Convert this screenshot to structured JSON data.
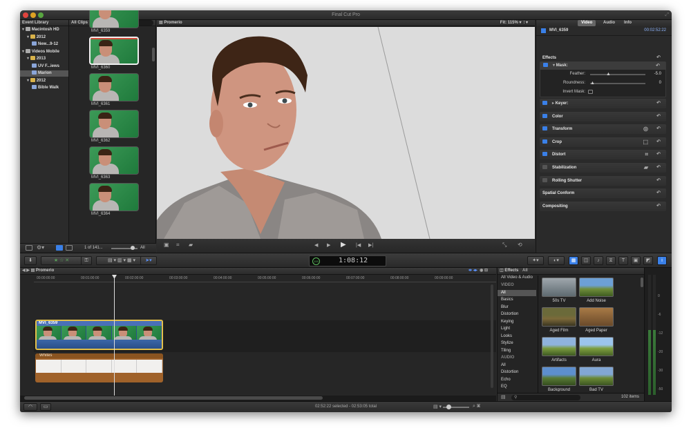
{
  "app": {
    "title": "Final Cut Pro"
  },
  "event_library": {
    "header": "Event Library",
    "items": [
      {
        "label": "Macintosh HD",
        "indent": 0,
        "sel": false
      },
      {
        "label": "2012",
        "indent": 1,
        "sel": false
      },
      {
        "label": "New...9-12",
        "indent": 2,
        "sel": false
      },
      {
        "label": "Videos Mobile",
        "indent": 0,
        "sel": false
      },
      {
        "label": "2013",
        "indent": 1,
        "sel": false
      },
      {
        "label": "UV F...iews",
        "indent": 2,
        "sel": false
      },
      {
        "label": "Marion",
        "indent": 2,
        "sel": true
      },
      {
        "label": "2012",
        "indent": 1,
        "sel": false
      },
      {
        "label": "Bible Walk",
        "indent": 2,
        "sel": false
      }
    ]
  },
  "browser": {
    "header": "All Clips",
    "clips": [
      {
        "name": "MVI_6359",
        "sel": false
      },
      {
        "name": "MVI_6360",
        "sel": true
      },
      {
        "name": "MVI_6361",
        "sel": false
      },
      {
        "name": "MVI_6362",
        "sel": false
      },
      {
        "name": "MVI_6363",
        "sel": false
      },
      {
        "name": "MVI_6364",
        "sel": false
      }
    ],
    "count_label": "1 of 141...",
    "all_label": "All"
  },
  "viewer": {
    "title": "Promerio",
    "fit_label": "Fit:",
    "zoom": "115%"
  },
  "inspector": {
    "tabs": [
      "Video",
      "Audio",
      "Info"
    ],
    "clip_name": "MVI_6359",
    "duration": "00:02:52:22",
    "section": "Effects",
    "mask": {
      "label": "Mask:",
      "feather_label": "Feather:",
      "feather_value": "-5.0",
      "roundness_label": "Roundness:",
      "roundness_value": "0",
      "invert_label": "Invert Mask:"
    },
    "rows": [
      "Keyer:",
      "Color",
      "Transform",
      "Crop",
      "Distort",
      "Stabilization",
      "Rolling Shutter",
      "Spatial Conform",
      "Compositing"
    ]
  },
  "toolbar": {
    "timecode": "1:08:12",
    "percent": "100"
  },
  "timeline": {
    "project": "Promerio",
    "ruler": [
      "00:00:00:00",
      "00:01:00:00",
      "00:02:00:00",
      "00:03:00:00",
      "00:04:00:00",
      "00:05:00:00",
      "00:06:00:00",
      "00:07:00:00",
      "00:08:00:00",
      "00:09:00:00"
    ],
    "video_clip": "MVI_6359",
    "title_clip": "Whites",
    "status": "02:52:22 selected - 02:53:05 total"
  },
  "effects": {
    "header": "Effects",
    "filter": "All",
    "subheader": "All Video & Audio",
    "categories": [
      {
        "label": "VIDEO",
        "type": "head"
      },
      {
        "label": "All",
        "type": "sel"
      },
      {
        "label": "Basics"
      },
      {
        "label": "Blur"
      },
      {
        "label": "Distortion"
      },
      {
        "label": "Keying"
      },
      {
        "label": "Light"
      },
      {
        "label": "Looks"
      },
      {
        "label": "Stylize"
      },
      {
        "label": "Tiling"
      },
      {
        "label": "AUDIO",
        "type": "head"
      },
      {
        "label": "All"
      },
      {
        "label": "Distortion"
      },
      {
        "label": "Echo"
      },
      {
        "label": "EQ"
      }
    ],
    "items": [
      "50s TV",
      "Add Noise",
      "Aged Film",
      "Aged Paper",
      "Artifacts",
      "Aura",
      "Background",
      "Bad TV"
    ],
    "count": "102 items"
  },
  "audio_meter": {
    "scale": [
      "0",
      "-6",
      "-12",
      "-20",
      "-30",
      "-50"
    ]
  }
}
